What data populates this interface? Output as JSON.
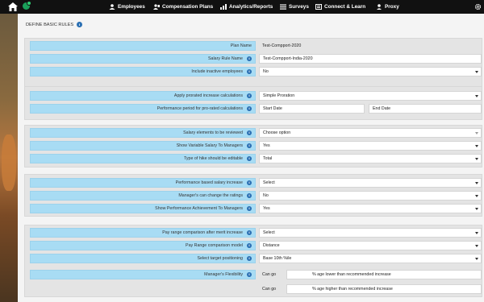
{
  "nav": {
    "items": [
      {
        "label": "Employees",
        "icon": "people-icon"
      },
      {
        "label": "Compensation Plans",
        "icon": "people-plan-icon"
      },
      {
        "label": "Analytics/Reports",
        "icon": "chart-icon"
      },
      {
        "label": "Surveys",
        "icon": "list-icon"
      },
      {
        "label": "Connect & Learn",
        "icon": "book-icon"
      },
      {
        "label": "Proxy",
        "icon": "person-icon"
      }
    ]
  },
  "section": {
    "title": "DEFINE BASIC RULES"
  },
  "groups": {
    "g1": {
      "plan_name": {
        "label": "Plan Name",
        "value": "Test-Compport-2020"
      },
      "salary_rule_name": {
        "label": "Salary Rule Name",
        "value": "Test-Compport-India-2020"
      },
      "include_inactive": {
        "label": "Include inactive employees",
        "value": "No"
      }
    },
    "g2": {
      "prorated": {
        "label": "Apply prorated increase calculations",
        "value": "Simple Proration"
      },
      "perf_period": {
        "label": "Performance period for pro-rated calculations",
        "start_placeholder": "Start Date",
        "end_placeholder": "End Date"
      }
    },
    "g3": {
      "salary_elements": {
        "label": "Salary elements to be reviewed",
        "value": "Choose option"
      },
      "show_variable": {
        "label": "Show Variable Salary To Managers",
        "value": "Yes"
      },
      "hike_type": {
        "label": "Type of hike should be editable",
        "value": "Total"
      }
    },
    "g4": {
      "perf_based": {
        "label": "Performance based salary increase",
        "value": "Select"
      },
      "manager_change": {
        "label": "Manager's can change the ratings",
        "value": "No"
      },
      "show_perf": {
        "label": "Show Performance Achievement To Managers",
        "value": "Yes"
      }
    },
    "g5": {
      "pay_range_merit": {
        "label": "Pay range comparison after merit increase",
        "value": "Select"
      },
      "pay_range_model": {
        "label": "Pay Range comparison model",
        "value": "Distance"
      },
      "target_position": {
        "label": "Select target positioning",
        "value": "Base 10th %ile"
      },
      "flexibility": {
        "label": "Manager's Flexibility",
        "can_go_1": "Can go",
        "desc_1": "% age lower than recommended increase",
        "can_go_2": "Can go",
        "desc_2": "% age higher than recommended increase"
      }
    }
  },
  "colors": {
    "label_bg": "#a8dcf4",
    "topbar": "#111111",
    "info": "#2a6fb3"
  }
}
